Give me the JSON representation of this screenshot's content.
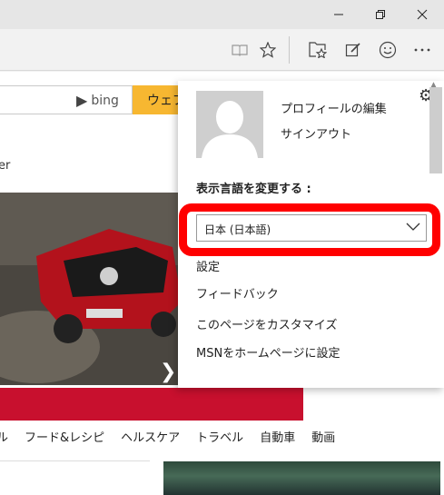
{
  "window": {
    "minimize_icon": "minimize-icon",
    "maximize_icon": "restore-icon",
    "close_icon": "close-icon"
  },
  "toolbar": {
    "icons": [
      "reading-view-icon",
      "favorite-star-icon",
      "favorites-hub-icon",
      "web-note-icon",
      "feedback-smiley-icon",
      "more-icon"
    ]
  },
  "page": {
    "bing_label": "bing",
    "search_button": "ウェブ",
    "nav_fragment": "er",
    "categories": [
      "ル",
      "フード&レシピ",
      "ヘルスケア",
      "トラベル",
      "自動車",
      "動画"
    ]
  },
  "panel": {
    "profile_edit": "プロフィールの編集",
    "signout": "サインアウト",
    "language_heading": "表示言語を変更する :",
    "language_selected": "日本 (日本語)",
    "menu": {
      "settings": "設定",
      "feedback": "フィードバック",
      "customize": "このページをカスタマイズ",
      "set_home": "MSNをホームページに設定"
    }
  },
  "colors": {
    "highlight": "#ff0000",
    "search_button": "#f7b731",
    "red_bar": "#c8102e"
  }
}
